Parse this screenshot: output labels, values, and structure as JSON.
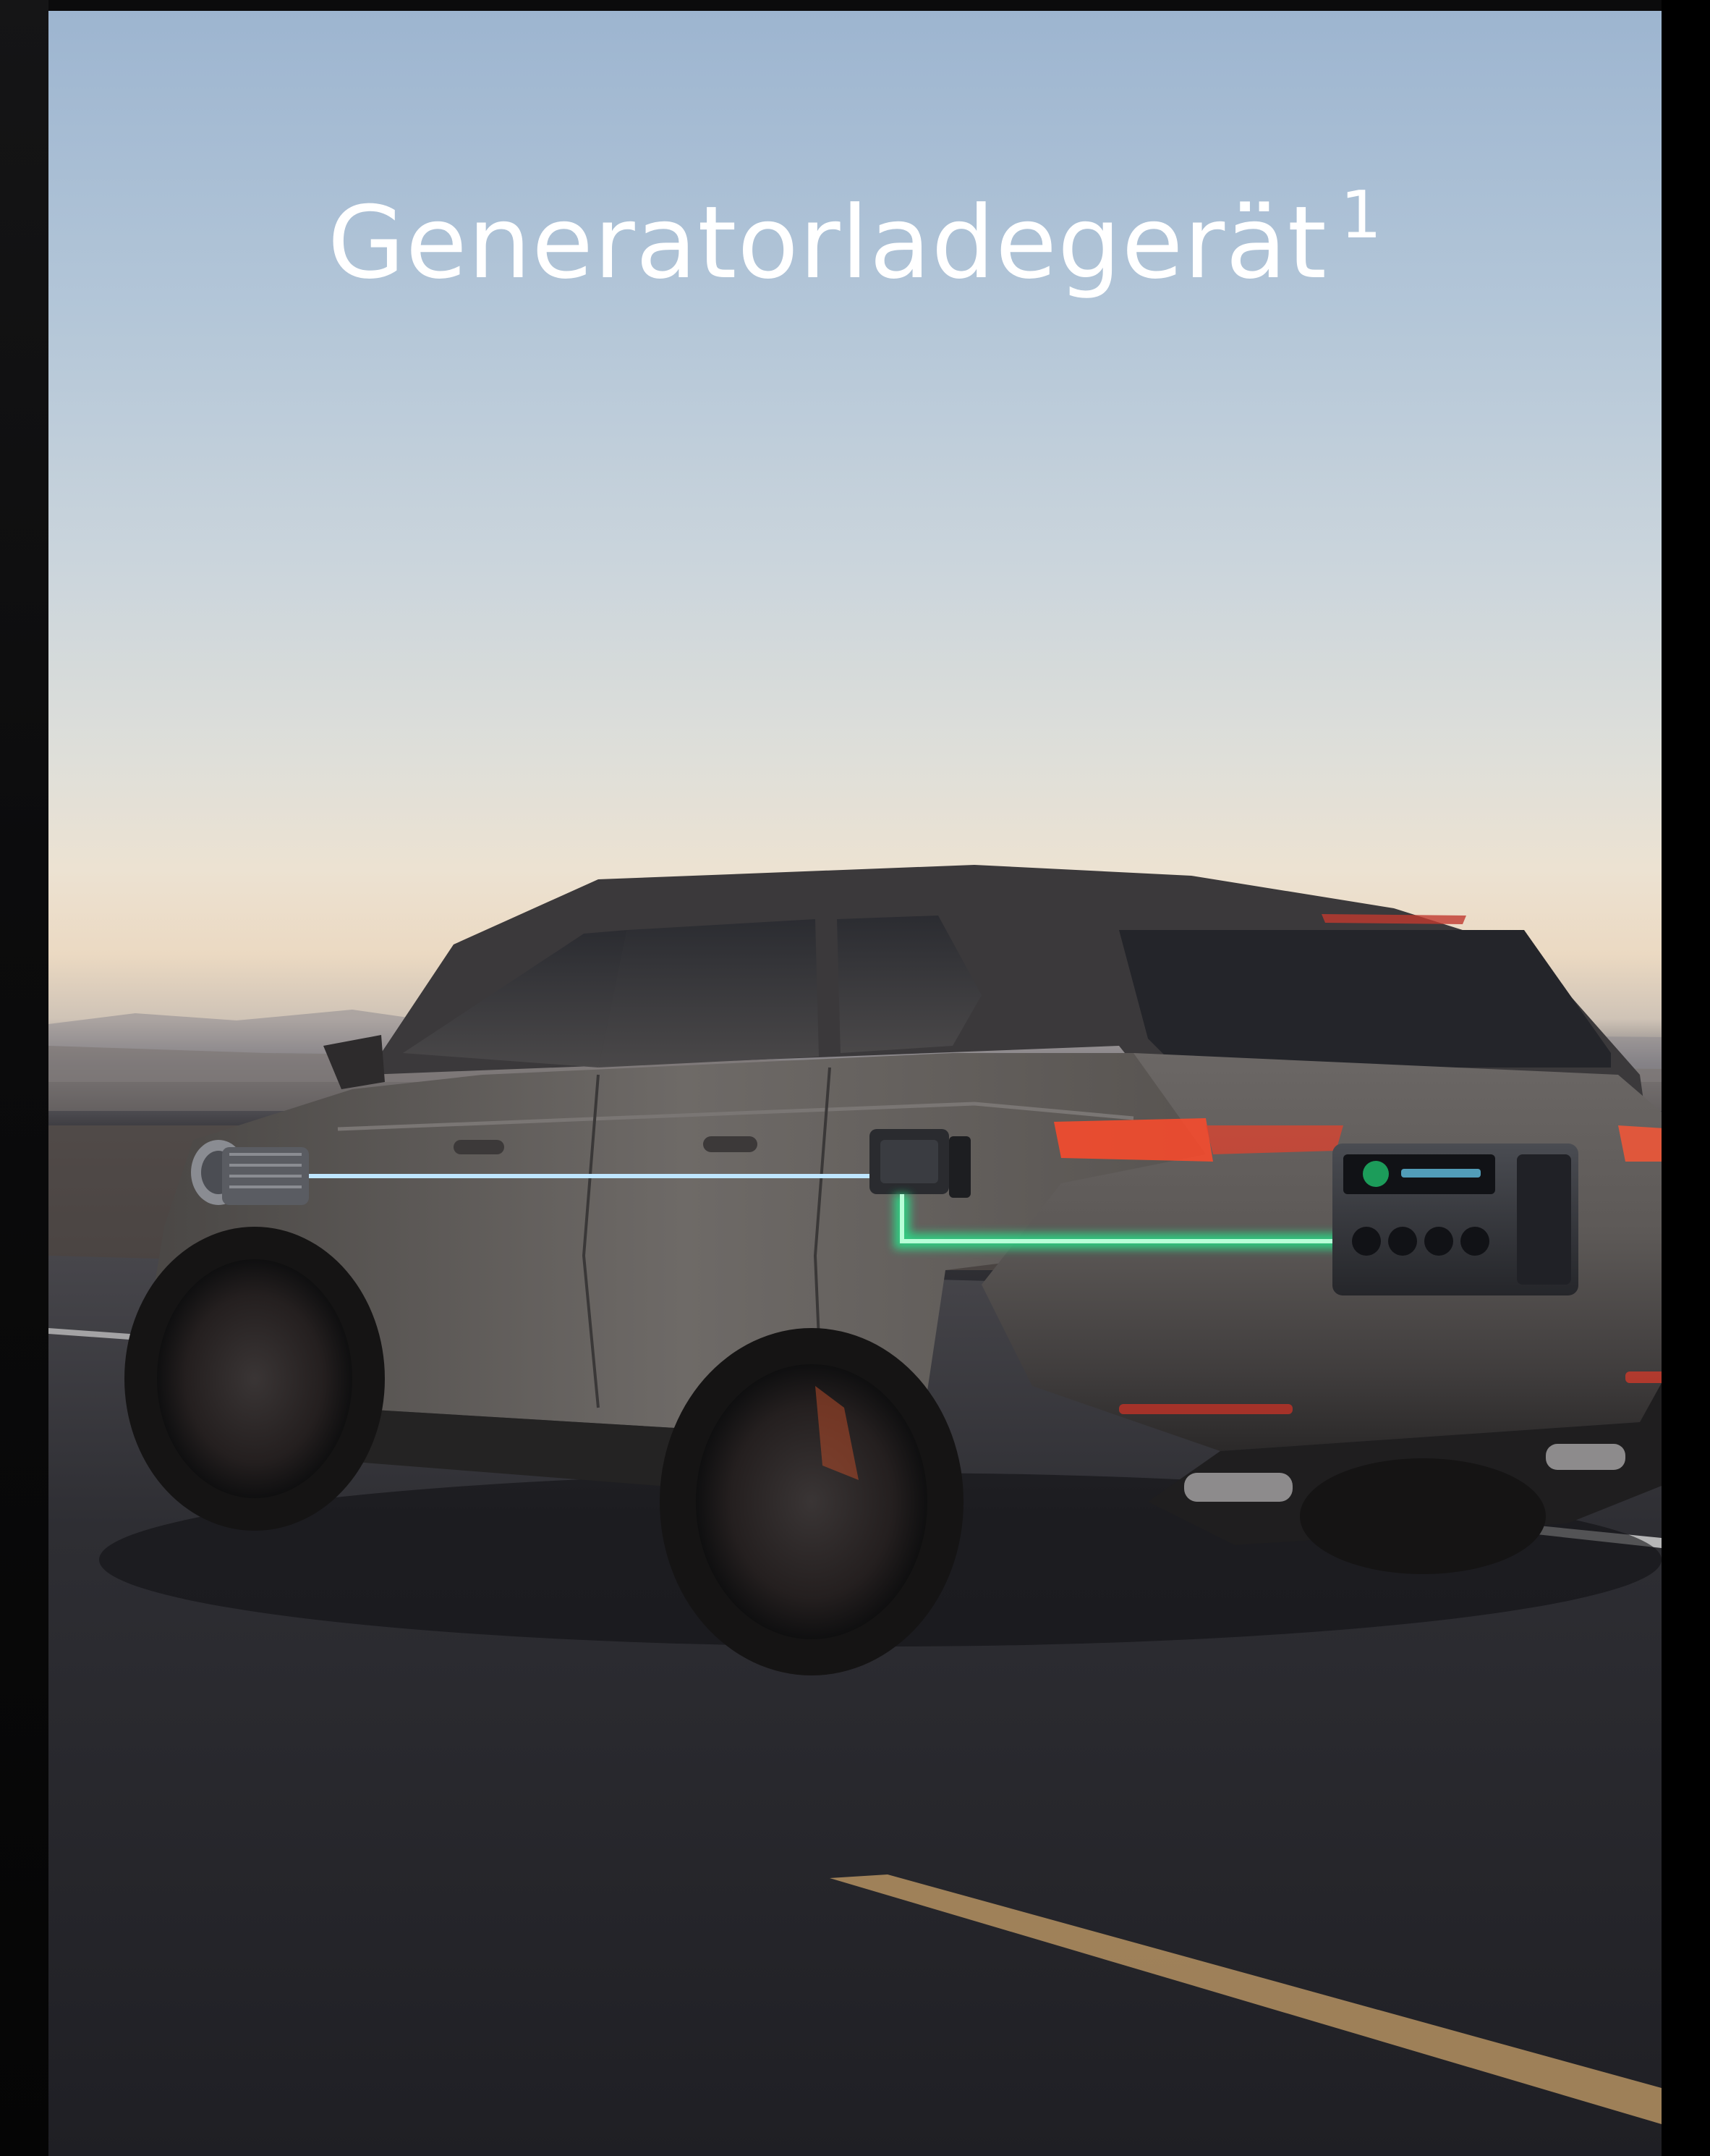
{
  "headline": {
    "text": "Generatorladegerät",
    "mark": "1"
  },
  "scene": {
    "icons": {
      "vehicle": "suv-icon",
      "alternator": "alternator-icon",
      "charger": "charger-box-icon",
      "power_station": "power-station-icon"
    },
    "colors": {
      "blue_line": "#3aa8ff",
      "green_line": "#25e58a",
      "car_body": "#5a5756",
      "taillight": "#ff4a2a"
    }
  }
}
